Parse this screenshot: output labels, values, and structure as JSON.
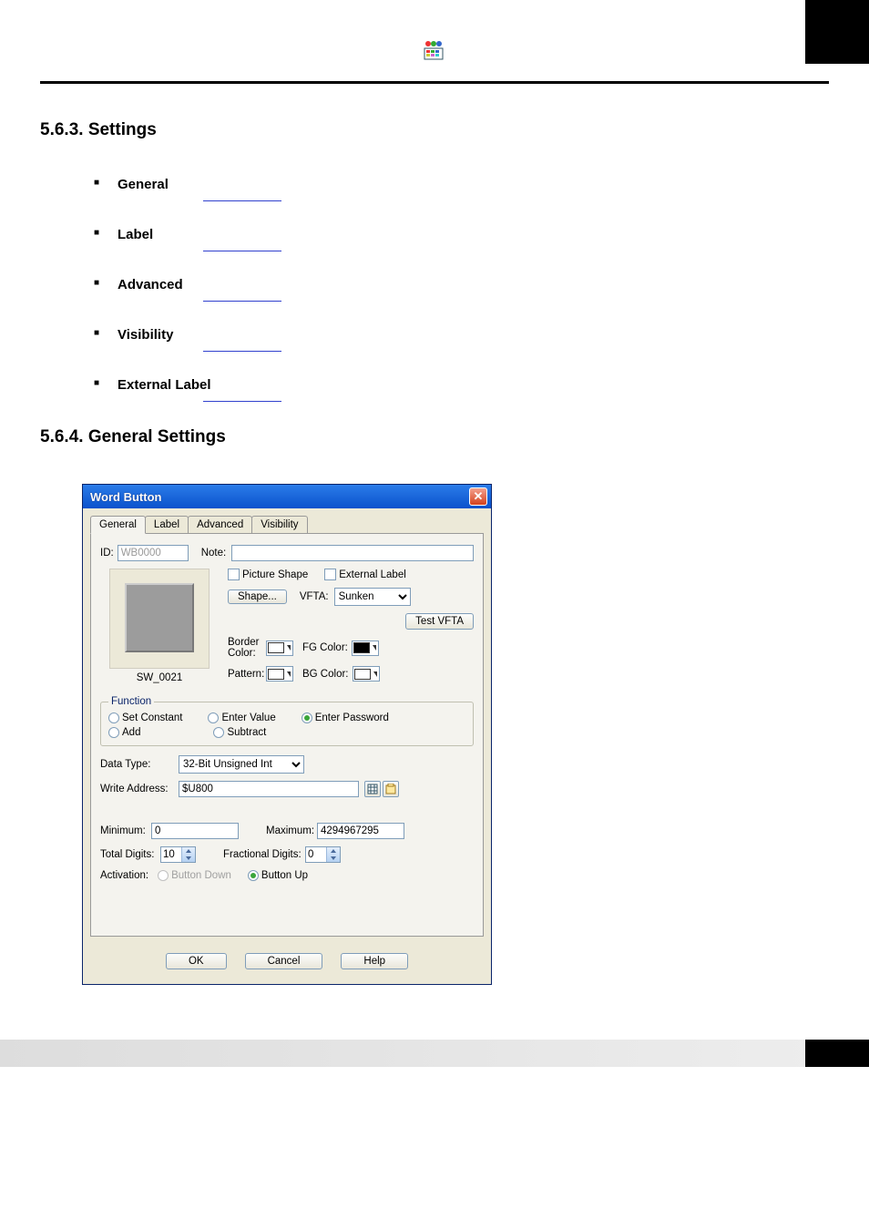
{
  "section1_title": "5.6.3. Settings",
  "section2_title": "5.6.4. General Settings",
  "bullets": {
    "general": "General",
    "label": "Label",
    "advanced": "Advanced",
    "visibility": "Visibility",
    "external_label": "External Label"
  },
  "dialog": {
    "title": "Word Button",
    "tabs": {
      "general": "General",
      "label": "Label",
      "advanced": "Advanced",
      "visibility": "Visibility"
    },
    "id_label": "ID:",
    "id_value": "WB0000",
    "note_label": "Note:",
    "note_value": "",
    "preview_label": "SW_0021",
    "picture_shape": "Picture Shape",
    "external_label": "External Label",
    "shape_btn": "Shape...",
    "vfta_label": "VFTA:",
    "vfta_value": "Sunken",
    "test_vfta": "Test VFTA",
    "border_color": "Border Color:",
    "fg_color": "FG Color:",
    "pattern": "Pattern:",
    "bg_color": "BG Color:",
    "function_legend": "Function",
    "fn_set_constant": "Set Constant",
    "fn_enter_value": "Enter Value",
    "fn_enter_password": "Enter Password",
    "fn_add": "Add",
    "fn_subtract": "Subtract",
    "data_type_label": "Data Type:",
    "data_type_value": "32-Bit Unsigned Int",
    "write_address_label": "Write Address:",
    "write_address_value": "$U800",
    "minimum_label": "Minimum:",
    "minimum_value": "0",
    "maximum_label": "Maximum:",
    "maximum_value": "4294967295",
    "total_digits_label": "Total Digits:",
    "total_digits_value": "10",
    "fractional_digits_label": "Fractional Digits:",
    "fractional_digits_value": "0",
    "activation_label": "Activation:",
    "activation_button_down": "Button Down",
    "activation_button_up": "Button Up",
    "ok": "OK",
    "cancel": "Cancel",
    "help": "Help",
    "colors": {
      "border": "#ffffff",
      "fg": "#000000",
      "pattern": "#ffffff",
      "bg": "#ffffff"
    }
  }
}
